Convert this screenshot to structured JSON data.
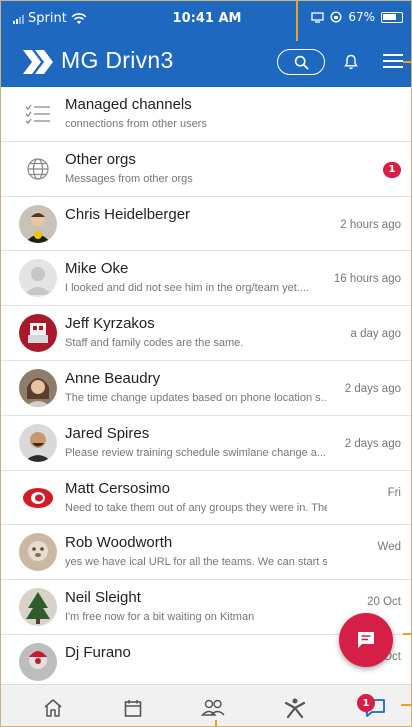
{
  "status_bar": {
    "carrier": "Sprint",
    "time": "10:41 AM",
    "battery": "67%"
  },
  "header": {
    "title": "MG Drivn3",
    "icons": [
      "logo-icon",
      "search-icon",
      "bell-icon",
      "menu-icon"
    ]
  },
  "list": {
    "special_rows": [
      {
        "title": "Managed channels",
        "subtitle": "connections from other users",
        "icon": "managed-channels-icon"
      },
      {
        "title": "Other orgs",
        "subtitle": "Messages from other orgs",
        "icon": "globe-icon",
        "badge": "1"
      }
    ],
    "conversations": [
      {
        "name": "Chris Heidelberger",
        "preview": "",
        "time": "2 hours ago"
      },
      {
        "name": "Mike Oke",
        "preview": "I looked and did not see him in the org/team yet....",
        "time": "16 hours ago"
      },
      {
        "name": "Jeff Kyrzakos",
        "preview": "Staff and family codes are the same.",
        "time": "a day ago"
      },
      {
        "name": "Anne Beaudry",
        "preview": "The time change updates based on phone location s...",
        "time": "2 days ago"
      },
      {
        "name": "Jared Spires",
        "preview": "Please review training schedule swimlane change a...",
        "time": "2 days ago"
      },
      {
        "name": "Matt Cersosimo",
        "preview": "Need to take them out of any groups they were in. They won'...",
        "time": "Fri"
      },
      {
        "name": "Rob Woodworth",
        "preview": "yes we have ical URL for all the teams. We can start setting...",
        "time": "Wed"
      },
      {
        "name": "Neil Sleight",
        "preview": "I'm free now for a bit waiting on Kitman",
        "time": "20 Oct"
      },
      {
        "name": "Dj Furano",
        "preview": "",
        "time": "21 Oct"
      }
    ]
  },
  "fab": {
    "icon": "new-message-icon"
  },
  "bottom_nav": {
    "items": [
      "home-icon",
      "calendar-icon",
      "people-icon",
      "activity-icon",
      "chat-icon"
    ],
    "chat_badge": "1"
  },
  "colors": {
    "brand": "#1f68c0",
    "accent": "#d61f46",
    "annotation": "#f0a020"
  }
}
